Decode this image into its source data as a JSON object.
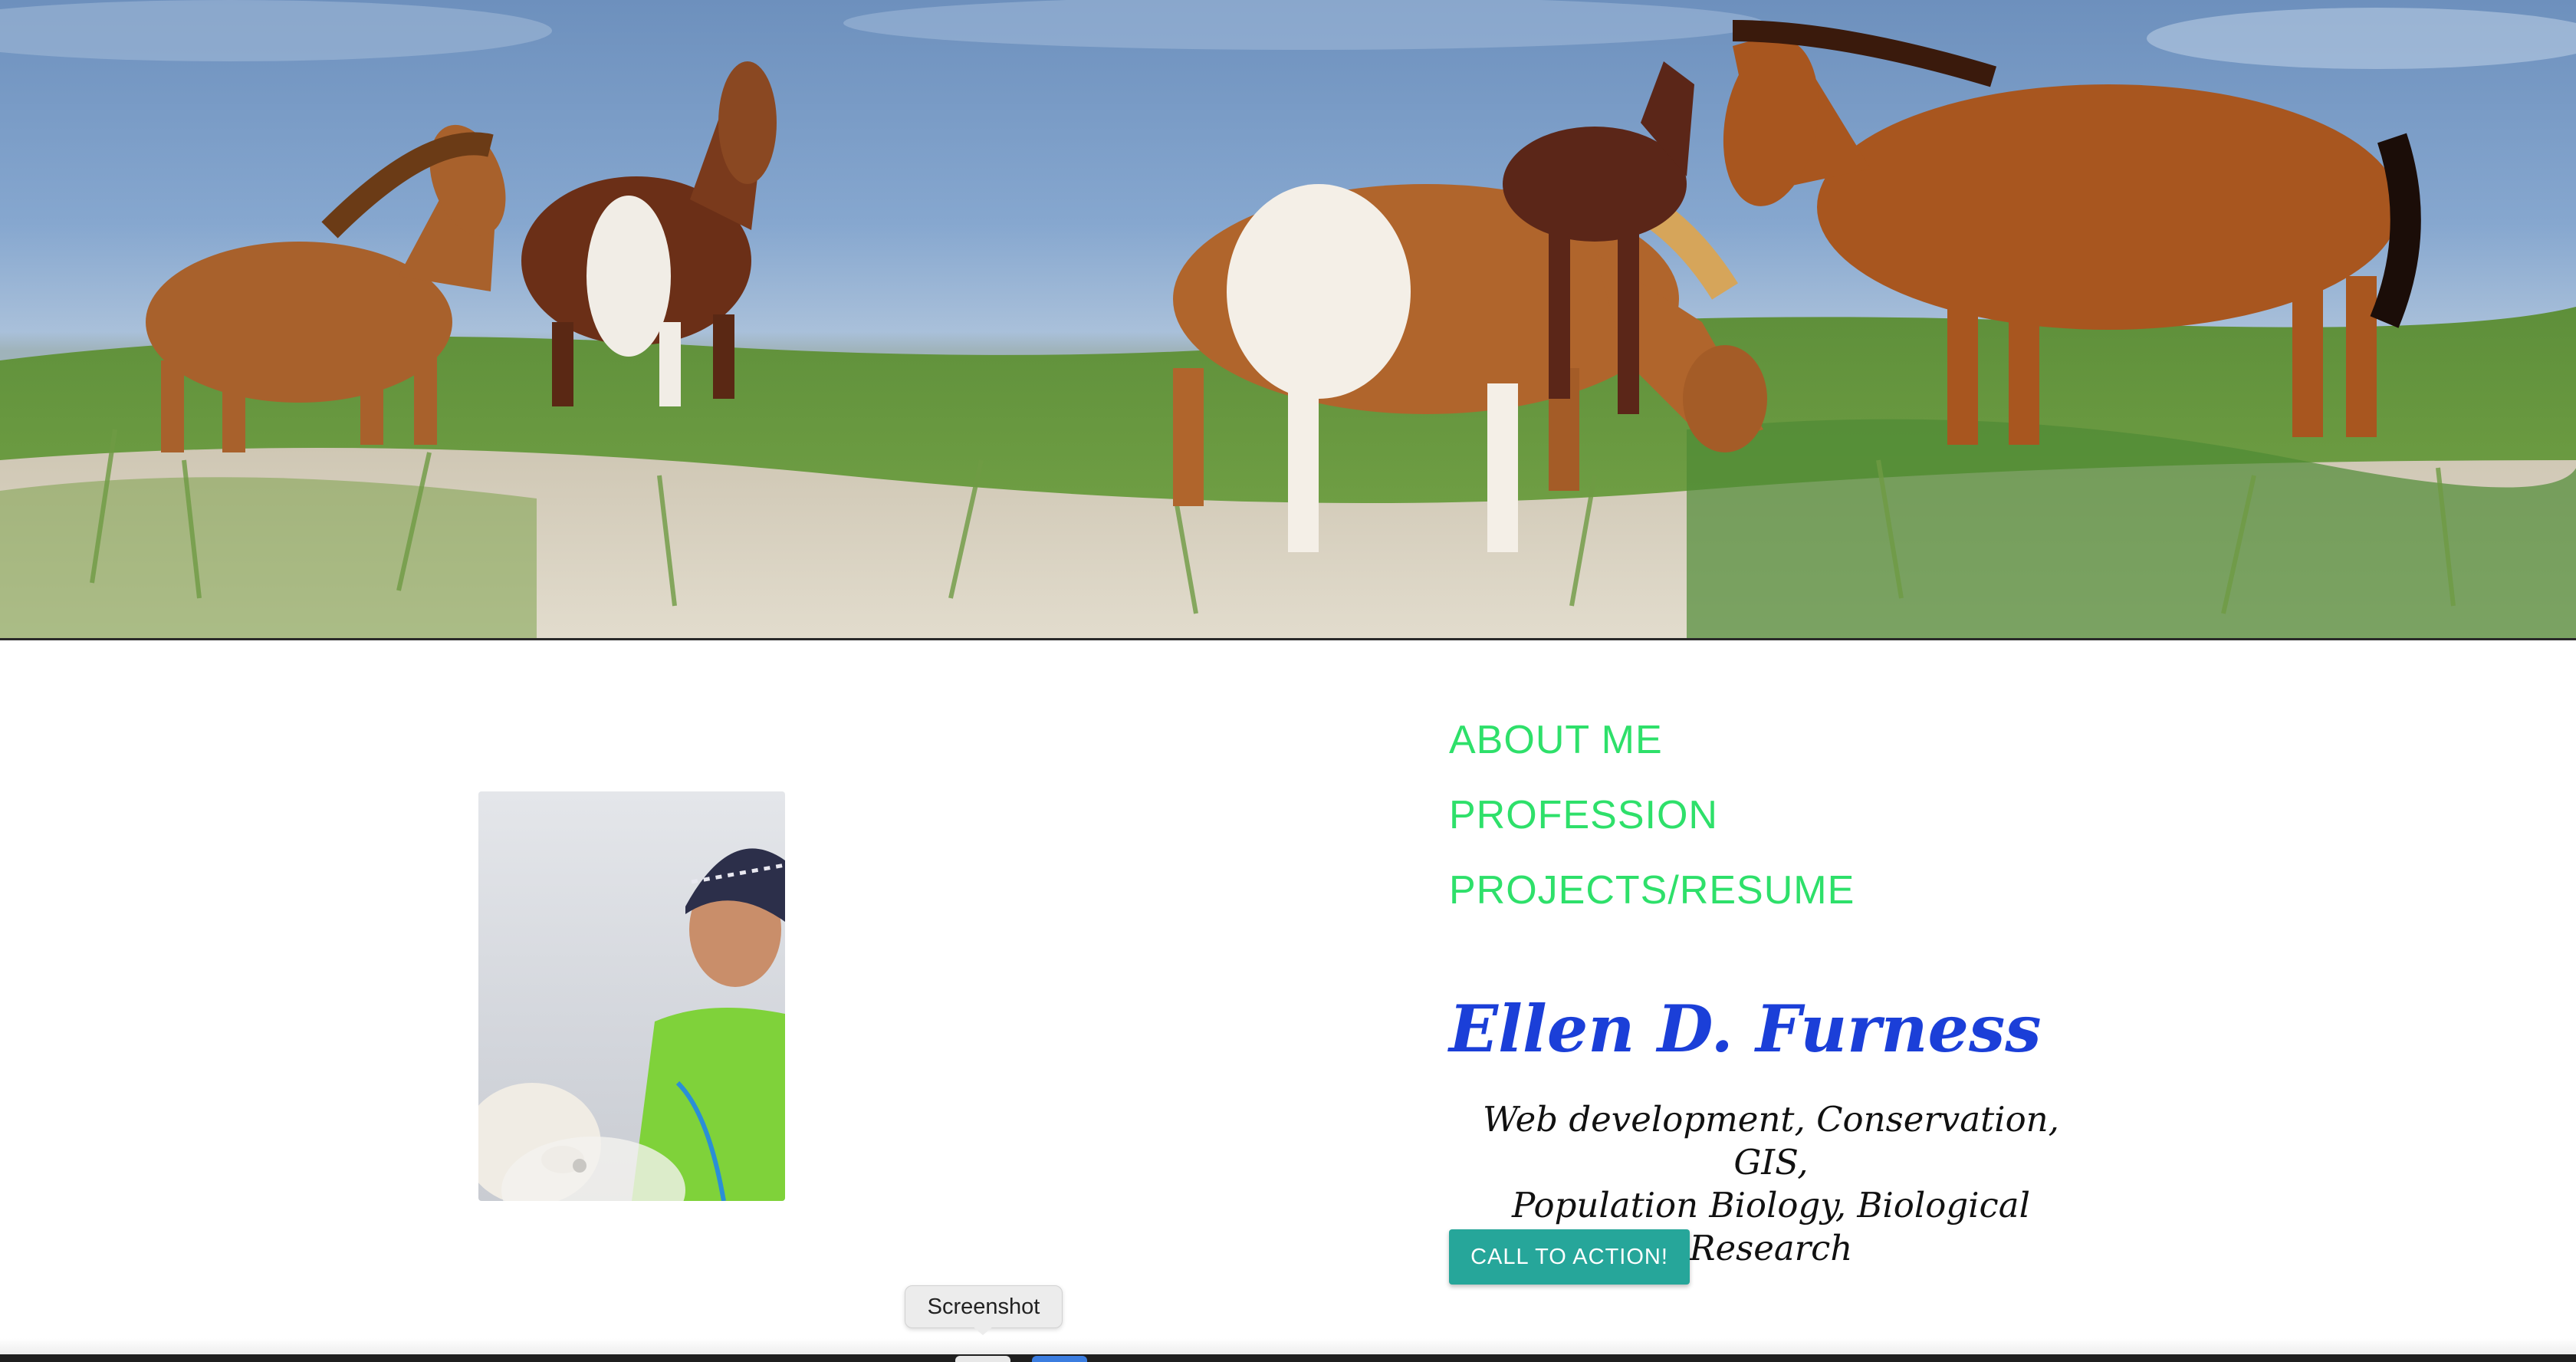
{
  "hero": {
    "image_icon": "wild-horses-banner-image"
  },
  "profile": {
    "photo_icon": "profile-photo-with-dog"
  },
  "nav": {
    "items": [
      {
        "label": "ABOUT ME"
      },
      {
        "label": "PROFESSION"
      },
      {
        "label": "PROJECTS/RESUME"
      }
    ],
    "color": "#2ee06a"
  },
  "intro": {
    "name": "Ellen D. Furness",
    "tagline_line1": "Web development, Conservation, GIS,",
    "tagline_line2": "Population Biology, Biological Research",
    "name_color": "#1b3fd8"
  },
  "cta": {
    "label": "CALL TO ACTION!",
    "color": "#26a69a"
  },
  "tooltip": {
    "text": "Screenshot"
  }
}
